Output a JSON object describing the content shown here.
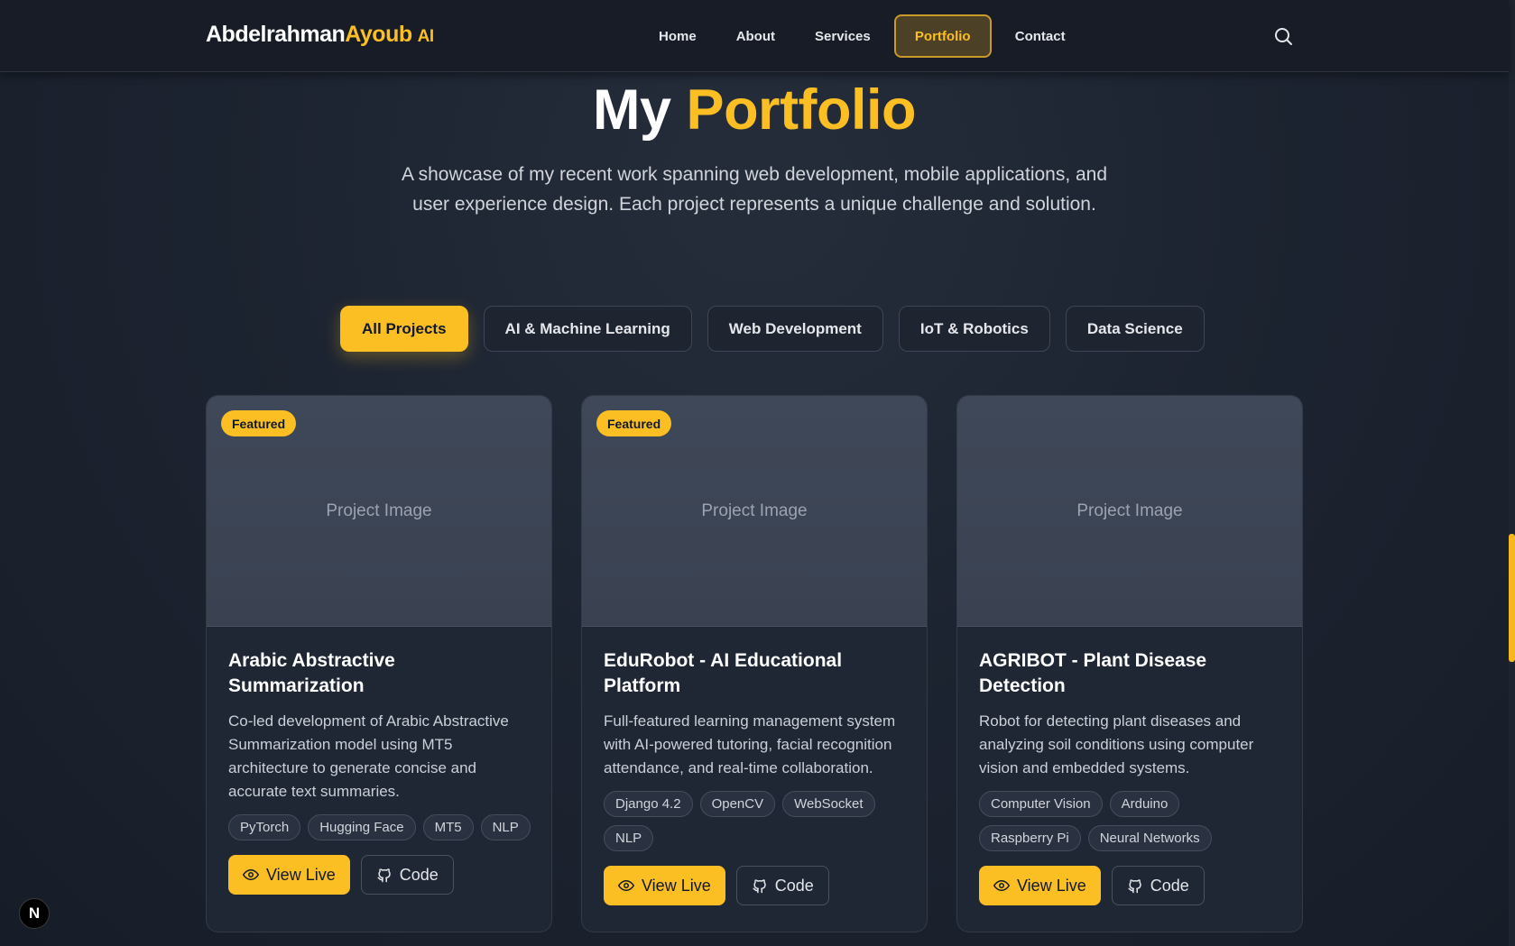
{
  "brand": {
    "first": "Abdelrahman",
    "last": "Ayoub",
    "suffix": "AI"
  },
  "nav": {
    "items": [
      {
        "label": "Home"
      },
      {
        "label": "About"
      },
      {
        "label": "Services"
      },
      {
        "label": "Portfolio"
      },
      {
        "label": "Contact"
      }
    ],
    "active": "Portfolio",
    "search_icon": "search-icon"
  },
  "hero": {
    "title_plain": "My",
    "title_accent": "Portfolio",
    "subtitle": "A showcase of my recent work spanning web development, mobile applications, and user experience design. Each project represents a unique challenge and solution."
  },
  "filters": {
    "items": [
      {
        "label": "All Projects"
      },
      {
        "label": "AI & Machine Learning"
      },
      {
        "label": "Web Development"
      },
      {
        "label": "IoT & Robotics"
      },
      {
        "label": "Data Science"
      }
    ],
    "active": "All Projects"
  },
  "projects": [
    {
      "badge": "Featured",
      "image_placeholder": "Project Image",
      "title": "Arabic Abstractive Summarization",
      "description": "Co-led development of Arabic Abstractive Summarization model using MT5 architecture to generate concise and accurate text summaries.",
      "tags": [
        "PyTorch",
        "Hugging Face",
        "MT5",
        "NLP"
      ],
      "live_label": "View Live",
      "code_label": "Code"
    },
    {
      "badge": "Featured",
      "image_placeholder": "Project Image",
      "title": "EduRobot - AI Educational Platform",
      "description": "Full-featured learning management system with AI-powered tutoring, facial recognition attendance, and real-time collaboration.",
      "tags": [
        "Django 4.2",
        "OpenCV",
        "WebSocket",
        "NLP"
      ],
      "live_label": "View Live",
      "code_label": "Code"
    },
    {
      "badge": "",
      "image_placeholder": "Project Image",
      "title": "AGRIBOT - Plant Disease Detection",
      "description": "Robot for detecting plant diseases and analyzing soil conditions using computer vision and embedded systems.",
      "tags": [
        "Computer Vision",
        "Arduino",
        "Raspberry Pi",
        "Neural Networks"
      ],
      "live_label": "View Live",
      "code_label": "Code"
    }
  ],
  "dev_badge": {
    "label": "N"
  },
  "colors": {
    "accent": "#fbbf24",
    "background": "#1d2431",
    "card": "#1f2634"
  }
}
